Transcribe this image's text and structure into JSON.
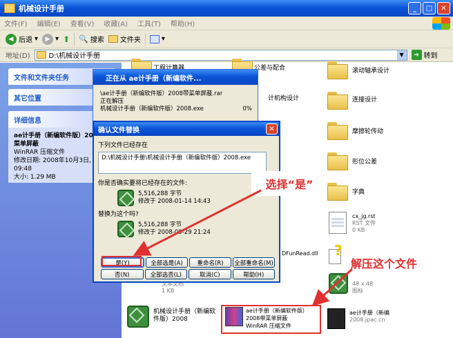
{
  "window": {
    "title": "机械设计手册"
  },
  "menu": [
    "文件(F)",
    "编辑(E)",
    "查看(V)",
    "收藏(A)",
    "工具(T)",
    "帮助(H)"
  ],
  "toolbar": {
    "back": "后退",
    "search": "搜索",
    "folders": "文件夹"
  },
  "address": {
    "label": "地址(D)",
    "value": "D:\\机械设计手册",
    "go": "转到"
  },
  "left_pane": {
    "tasks": "文件和文件夹任务",
    "other": "其它位置",
    "details_title": "详细信息",
    "details": {
      "name": "ae计手册（新编软件版）2008带菜单屏蔽",
      "type": "WinRAR 压缩文件",
      "modified": "修改日期: 2008年10月3日, 09:48",
      "size": "大小: 1.29 MB"
    }
  },
  "folders": [
    {
      "label": "工程计算器"
    },
    {
      "label": "公差与配合"
    },
    {
      "label": "滚动轴承设计"
    },
    {
      "label": "连接设计"
    },
    {
      "label": "摩擦轮传动"
    },
    {
      "label": "形位公差"
    },
    {
      "label": "字典"
    }
  ],
  "files": {
    "cx_jg": {
      "name": "cx_jg.rst",
      "type": "RST 文件",
      "size": "0 KB"
    },
    "dll": {
      "name": "DFunRead.dll"
    },
    "icon48": {
      "name": "48 x 48",
      "type": "图标"
    },
    "exe": {
      "name": "机械设计手册（新编软件版）2008"
    },
    "rar": {
      "name": "ae计手册（新编软件版）2008带菜单屏蔽",
      "type": "WinRAR 压缩文件"
    },
    "ap": {
      "name": "ae计手册（新编",
      "extra": "2008.jpac.cn"
    },
    "textdoc": {
      "type": "文本文档",
      "size": "1 KB"
    },
    "textdoc2": {
      "type": "文本文档",
      "size": "1 KB"
    }
  },
  "extract_dialog": {
    "title": "正在从 ae计手册（新编软件...",
    "line1": "\\ae计手册（新编软件版）2008带菜单屏蔽.rar",
    "line2": "正在解压",
    "line3": "机械设计手册（新编软件版）2008.exe",
    "pct": "0%"
  },
  "confirm_dialog": {
    "title": "确认文件替换",
    "exists": "下列文件已经存在",
    "path": "D:\\机械设计手册\\机械设计手册（新编软件版）2008.exe",
    "question": "你是否确实要将已经存在的文件:",
    "old_size": "5,516,288 字节",
    "old_date": "修改于 2008-01-14 14:43",
    "replace": "替换为这个吗?",
    "new_size": "5,516,288 字节",
    "new_date": "修改于 2008-09-29 21:24",
    "buttons_row1": [
      "是(Y)",
      "全部选是(A)",
      "重命名(R)",
      "全部重命名(M)"
    ],
    "buttons_row2": [
      "否(N)",
      "全部选否(L)",
      "取消(C)",
      "帮助(H)"
    ]
  },
  "annotations": {
    "select_yes": "选择“是”",
    "unzip": "解压这个文件"
  }
}
